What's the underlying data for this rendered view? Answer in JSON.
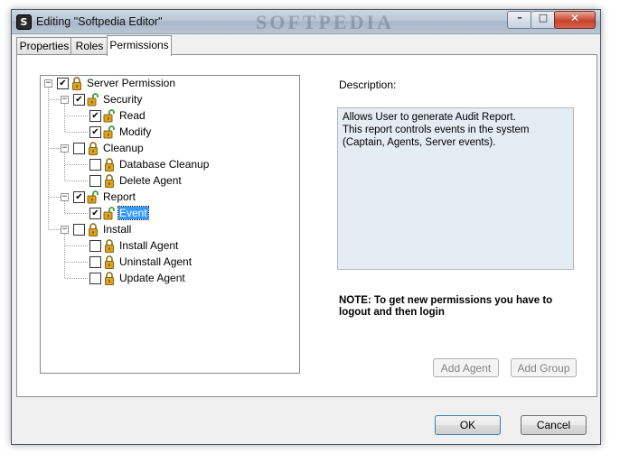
{
  "window": {
    "title": "Editing \"Softpedia Editor\"",
    "app_icon_letter": "S",
    "watermark": "SOFTPEDIA"
  },
  "tabs": [
    {
      "label": "Properties",
      "active": false
    },
    {
      "label": "Roles",
      "active": false
    },
    {
      "label": "Permissions",
      "active": true
    }
  ],
  "tree": {
    "root": {
      "label": "Server Permission",
      "checked": true,
      "expanded": true
    },
    "groups": [
      {
        "label": "Security",
        "checked": true,
        "expanded": true,
        "lock": "open",
        "children": [
          {
            "label": "Read",
            "checked": true,
            "lock": "open"
          },
          {
            "label": "Modify",
            "checked": true,
            "lock": "open"
          }
        ]
      },
      {
        "label": "Cleanup",
        "checked": false,
        "expanded": true,
        "lock": "closed",
        "children": [
          {
            "label": "Database Cleanup",
            "checked": false,
            "lock": "closed"
          },
          {
            "label": "Delete Agent",
            "checked": false,
            "lock": "closed"
          }
        ]
      },
      {
        "label": "Report",
        "checked": true,
        "expanded": true,
        "lock": "open",
        "children": [
          {
            "label": "Event",
            "checked": true,
            "lock": "open",
            "selected": true
          }
        ]
      },
      {
        "label": "Install",
        "checked": false,
        "expanded": true,
        "lock": "closed",
        "children": [
          {
            "label": "Install Agent",
            "checked": false,
            "lock": "closed"
          },
          {
            "label": "Uninstall Agent",
            "checked": false,
            "lock": "closed"
          },
          {
            "label": "Update Agent",
            "checked": false,
            "lock": "closed"
          }
        ]
      }
    ]
  },
  "description": {
    "label": "Description:",
    "text_line1": "Allows User to generate Audit Report.",
    "text_line2": "This report controls events in the system (Captain, Agents, Server events)."
  },
  "note": "NOTE: To get new permissions you have to logout and then login",
  "buttons": {
    "add_agent": "Add Agent",
    "add_group": "Add Group",
    "ok": "OK",
    "cancel": "Cancel"
  },
  "icons": {
    "lock_open": "lock-open-icon",
    "lock_closed": "lock-closed-icon",
    "expander": "minus-expander-icon"
  },
  "colors": {
    "selection": "#3399ff",
    "description_bg": "#e4ecf4",
    "lock_gold": "#d9a520",
    "lock_open_green": "#3a9a3a"
  }
}
